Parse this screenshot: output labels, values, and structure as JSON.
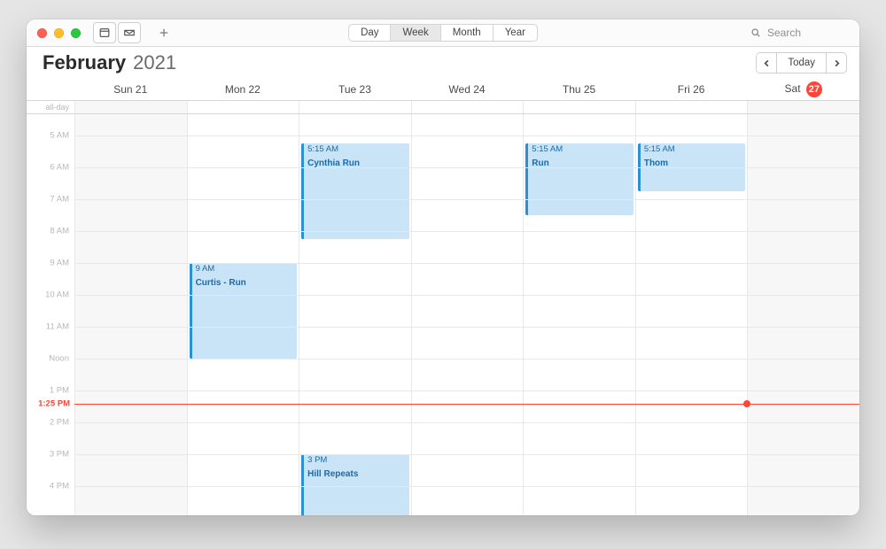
{
  "colors": {
    "event_bg": "#c9e4f6",
    "event_bar": "#2a90d8",
    "event_text": "#1d6aa8",
    "now_line": "#ff453a",
    "today_badge": "#ff453a"
  },
  "toolbar": {
    "views": [
      "Day",
      "Week",
      "Month",
      "Year"
    ],
    "selected_view": "Week",
    "icons": [
      "calendars-icon",
      "inbox-icon"
    ],
    "add_icon": "plus-icon"
  },
  "search": {
    "placeholder": "Search"
  },
  "header": {
    "month": "February",
    "year": "2021",
    "today_label": "Today"
  },
  "days": [
    {
      "dow": "Sun",
      "num": "21",
      "weekend": true,
      "today": false
    },
    {
      "dow": "Mon",
      "num": "22",
      "weekend": false,
      "today": false
    },
    {
      "dow": "Tue",
      "num": "23",
      "weekend": false,
      "today": false
    },
    {
      "dow": "Wed",
      "num": "24",
      "weekend": false,
      "today": false
    },
    {
      "dow": "Thu",
      "num": "25",
      "weekend": false,
      "today": false
    },
    {
      "dow": "Fri",
      "num": "26",
      "weekend": false,
      "today": false
    },
    {
      "dow": "Sat",
      "num": "27",
      "weekend": true,
      "today": true
    }
  ],
  "allday_label": "all-day",
  "visible_hours": {
    "start": 4.333,
    "end": 17,
    "labels": [
      {
        "h": 5,
        "label": "5 AM"
      },
      {
        "h": 6,
        "label": "6 AM"
      },
      {
        "h": 7,
        "label": "7 AM"
      },
      {
        "h": 8,
        "label": "8 AM"
      },
      {
        "h": 9,
        "label": "9 AM"
      },
      {
        "h": 10,
        "label": "10 AM"
      },
      {
        "h": 11,
        "label": "11 AM"
      },
      {
        "h": 12,
        "label": "Noon"
      },
      {
        "h": 13,
        "label": "1 PM"
      },
      {
        "h": 14,
        "label": "2 PM"
      },
      {
        "h": 15,
        "label": "3 PM"
      },
      {
        "h": 16,
        "label": "4 PM"
      }
    ]
  },
  "now": {
    "label": "1:25 PM",
    "hour": 13.4167
  },
  "events": [
    {
      "day": 1,
      "start": 9.0,
      "end": 12.0,
      "time_label": "9 AM",
      "title": "Curtis - Run"
    },
    {
      "day": 2,
      "start": 5.25,
      "end": 8.25,
      "time_label": "5:15 AM",
      "title": "Cynthia Run"
    },
    {
      "day": 2,
      "start": 15.0,
      "end": 18.0,
      "time_label": "3 PM",
      "title": "Hill Repeats"
    },
    {
      "day": 4,
      "start": 5.25,
      "end": 7.5,
      "time_label": "5:15 AM",
      "title": "Run"
    },
    {
      "day": 5,
      "start": 5.25,
      "end": 6.75,
      "time_label": "5:15 AM",
      "title": "Thom"
    }
  ]
}
